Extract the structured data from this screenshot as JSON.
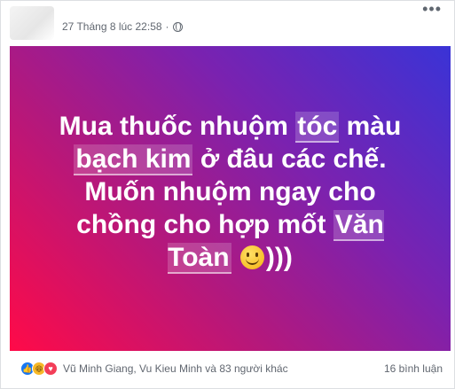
{
  "post": {
    "timestamp": "27 Tháng 8 lúc 22:58",
    "separator": "·",
    "privacy_icon": "globe-icon",
    "more_icon": "more-options-icon",
    "text": {
      "part1": "Mua thuốc nhuộm ",
      "tag1": "tóc",
      "part2": " màu ",
      "tag2": "bạch kim",
      "part3": " ở đâu các chế. Muốn nhuộm ngay cho chồng cho hợp mốt ",
      "tag3": "Văn Toàn",
      "part4": ")))"
    },
    "emoji": "smiling-face-icon",
    "background_colors": [
      "#ff0a48",
      "#b4187c",
      "#7a22b0",
      "#3a33d6"
    ]
  },
  "footer": {
    "reactions": [
      "like-icon",
      "haha-icon",
      "love-icon"
    ],
    "reactors": "Vũ Minh Giang, Vu Kieu Minh và 83 người khác",
    "comments": "16 bình luận"
  }
}
